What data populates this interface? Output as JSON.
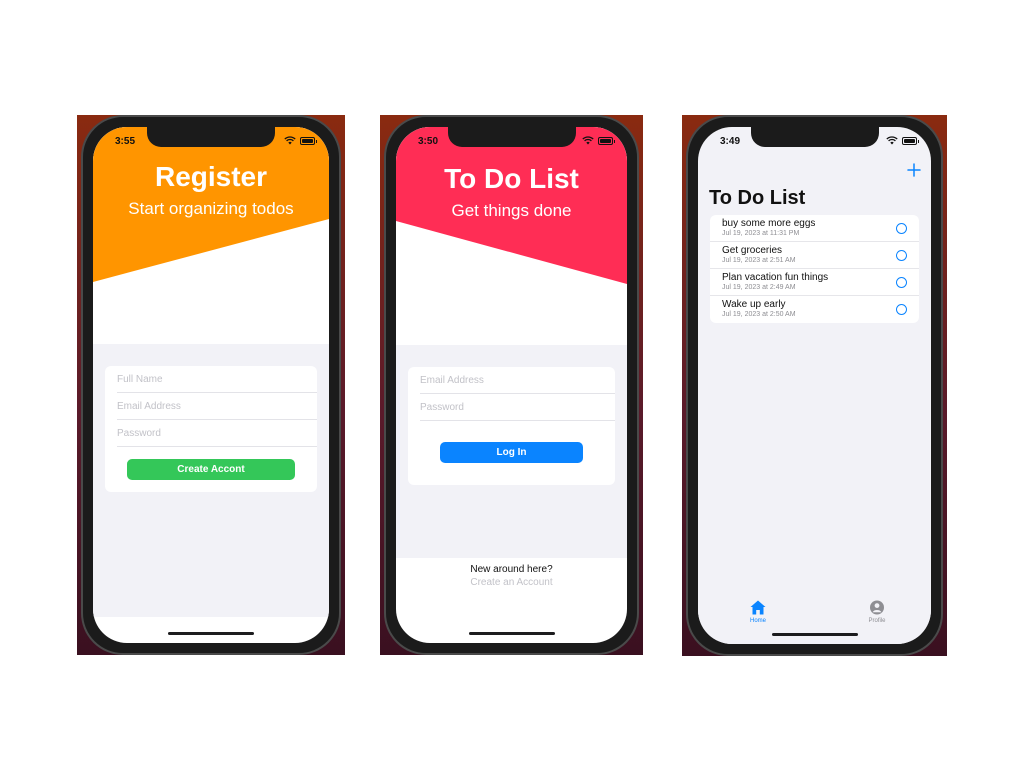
{
  "register_screen": {
    "status_time": "3:55",
    "title": "Register",
    "subtitle": "Start organizing todos",
    "banner_color": "#ff9500",
    "fields": {
      "full_name_placeholder": "Full Name",
      "email_placeholder": "Email Address",
      "password_placeholder": "Password"
    },
    "create_button_label": "Create Accont"
  },
  "login_screen": {
    "status_time": "3:50",
    "title": "To Do List",
    "subtitle": "Get things done",
    "banner_color": "#ff2d55",
    "fields": {
      "email_placeholder": "Email Address",
      "password_placeholder": "Password"
    },
    "login_button_label": "Log In",
    "footer_prompt": "New around here?",
    "footer_link": "Create an Account"
  },
  "list_screen": {
    "status_time": "3:49",
    "title": "To Do List",
    "add_icon": "plus-icon",
    "items": [
      {
        "title": "buy some more eggs",
        "date": "Jul 19, 2023 at 11:31 PM"
      },
      {
        "title": "Get groceries",
        "date": "Jul 19, 2023 at 2:51 AM"
      },
      {
        "title": "Plan vacation fun things",
        "date": "Jul 19, 2023 at 2:49 AM"
      },
      {
        "title": "Wake up early",
        "date": "Jul 19, 2023 at 2:50 AM"
      }
    ],
    "tabs": [
      {
        "label": "Home",
        "icon": "house-icon",
        "active": true
      },
      {
        "label": "Profile",
        "icon": "person-circle-icon",
        "active": false
      }
    ]
  },
  "colors": {
    "accent_blue": "#0a84ff",
    "accent_green": "#34c759",
    "inactive_gray": "#8e8e93"
  }
}
